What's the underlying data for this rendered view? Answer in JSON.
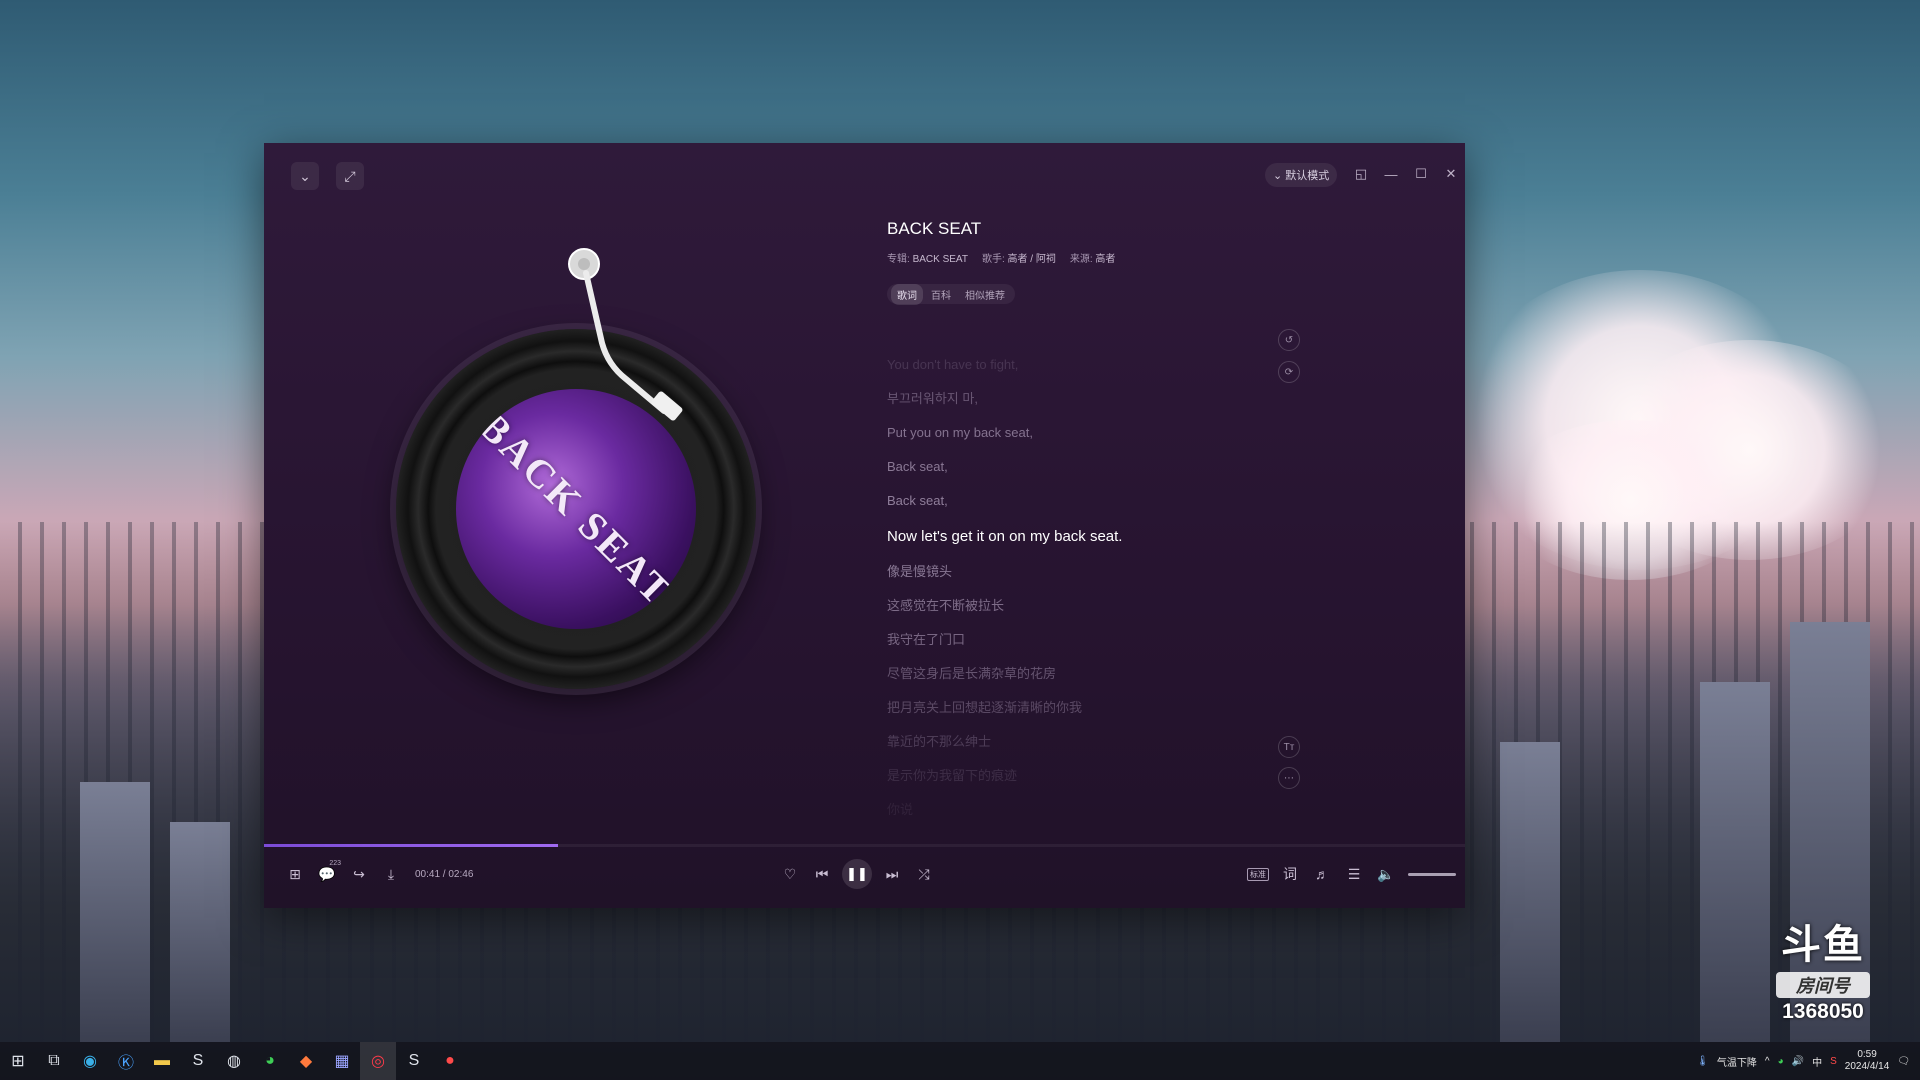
{
  "player": {
    "collapse_icon": "chevron-down-icon",
    "fullscreen_icon": "expand-icon",
    "mode_label": "默认模式",
    "song": {
      "title": "BACK SEAT",
      "album_label": "专辑:",
      "album": "BACK SEAT",
      "artist_label": "歌手:",
      "artist": "高者 / 阿祠",
      "source_label": "来源:",
      "source": "高者",
      "cover_text": "BACK SEAT"
    },
    "tabs": [
      {
        "label": "歌词",
        "active": true
      },
      {
        "label": "百科",
        "active": false
      },
      {
        "label": "相似推荐",
        "active": false
      }
    ],
    "lyrics": [
      {
        "text": "You don't have to fight,",
        "opacity": 0.25
      },
      {
        "text": "부끄러워하지 마,",
        "opacity": 0.55
      },
      {
        "text": "Put you on my back seat,",
        "opacity": 0.8
      },
      {
        "text": "Back seat,",
        "opacity": 0.85
      },
      {
        "text": "Back seat,",
        "opacity": 0.9
      },
      {
        "text": "Now let's get it on on my back seat.",
        "current": true
      },
      {
        "text": "像是慢镜头",
        "opacity": 0.85
      },
      {
        "text": "这感觉在不断被拉长",
        "opacity": 0.75
      },
      {
        "text": "我守在了门口",
        "opacity": 0.7
      },
      {
        "text": "尽管这身后是长满杂草的花房",
        "opacity": 0.55
      },
      {
        "text": "把月亮关上回想起逐渐清晰的你我",
        "opacity": 0.45
      },
      {
        "text": "靠近的不那么绅士",
        "opacity": 0.35
      },
      {
        "text": "是示你为我留下的痕迹",
        "opacity": 0.22
      },
      {
        "text": "你说",
        "opacity": 0.12
      }
    ],
    "side_icons": [
      "history-icon",
      "refresh-icon",
      "text-size-icon",
      "more-icon"
    ],
    "playback": {
      "current_time": "00:41",
      "duration": "02:46",
      "time_display": "00:41 / 02:46",
      "progress": 0.245,
      "comment_count": "223",
      "quality_label": "标准",
      "volume": 1.0
    }
  },
  "watermark": {
    "logo": "斗鱼",
    "room_label": "房间号",
    "room_number": "1368050"
  },
  "taskbar": {
    "weather": "气温下降",
    "ime": "中",
    "time": "0:59",
    "date": "2024/4/14"
  },
  "colors": {
    "accent": "#8b57e6",
    "player_bg": "#2a1634"
  }
}
